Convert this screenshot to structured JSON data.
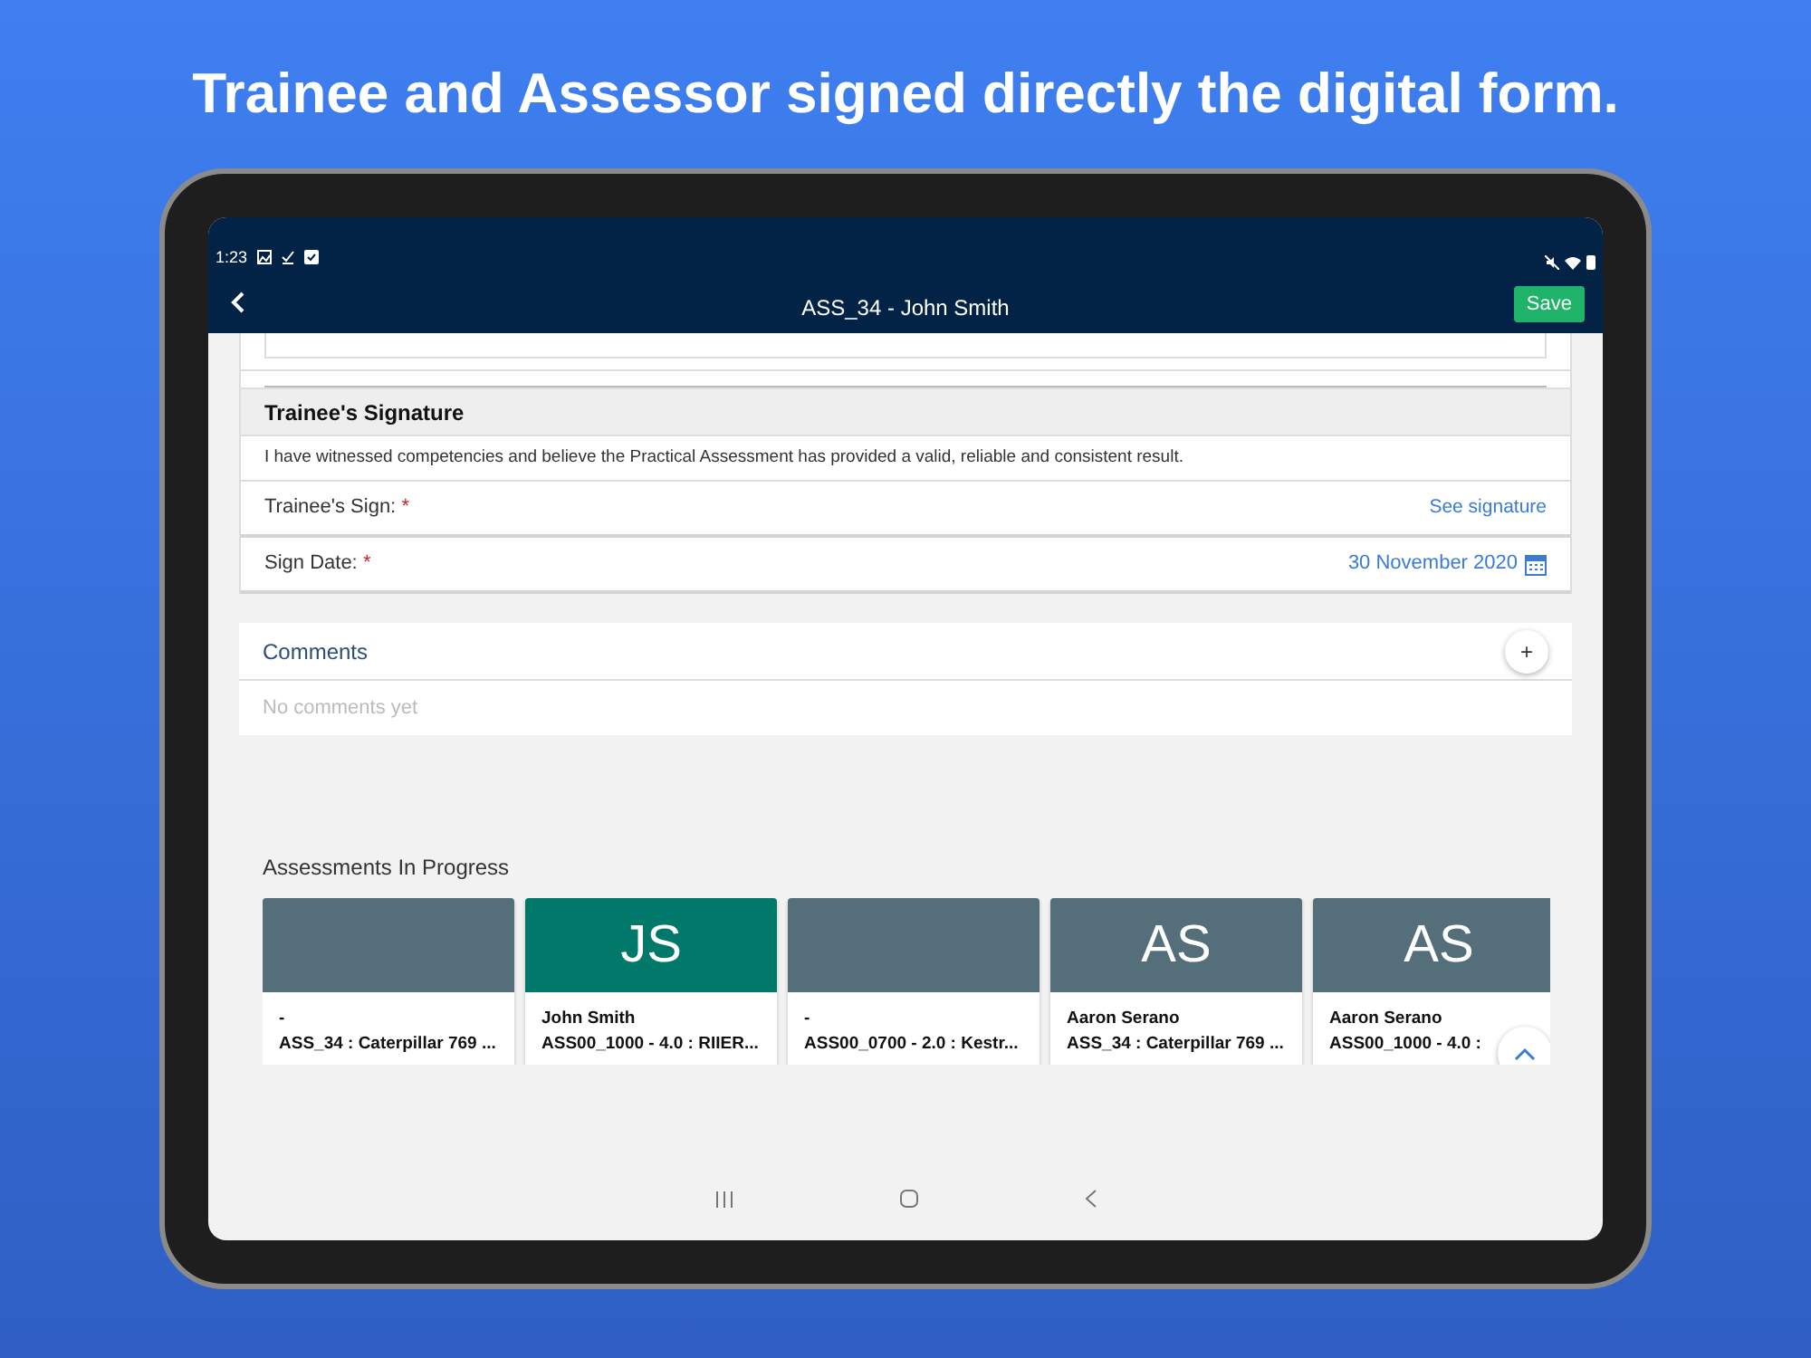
{
  "headline": "Trainee and Assessor signed directly the digital form.",
  "status_bar": {
    "time": "1:23"
  },
  "app_bar": {
    "title": "ASS_34 - John Smith",
    "save_button": "Save"
  },
  "signature_section": {
    "title": "Trainee's Signature",
    "statement": "I have witnessed competencies and believe the Practical Assessment has provided a valid, reliable and consistent result.",
    "fields": [
      {
        "kind": "link",
        "label": "Trainee's Sign:",
        "required_mark": "*",
        "value": "See signature"
      },
      {
        "kind": "date",
        "label": "Sign Date:",
        "required_mark": "*",
        "value": "30 November 2020"
      }
    ]
  },
  "comments": {
    "title": "Comments",
    "add_button": "+",
    "empty_text": "No comments yet"
  },
  "assessments_in_progress": {
    "title": "Assessments In Progress",
    "cards": [
      {
        "color": "#546e7a",
        "name": "-",
        "assessment": "ASS_34 : Caterpillar 769 ..."
      },
      {
        "initials": "JS",
        "color": "#00796b",
        "name": "John Smith",
        "assessment": "ASS00_1000 - 4.0 : RIIER..."
      },
      {
        "color": "#546e7a",
        "name": "-",
        "assessment": "ASS00_0700 - 2.0 : Kestr..."
      },
      {
        "initials": "AS",
        "color": "#546e7a",
        "name": "Aaron Serano",
        "assessment": "ASS_34 : Caterpillar 769 ..."
      },
      {
        "initials": "AS",
        "color": "#546e7a",
        "name": "Aaron Serano",
        "assessment": "ASS00_1000 - 4.0 :"
      }
    ]
  }
}
